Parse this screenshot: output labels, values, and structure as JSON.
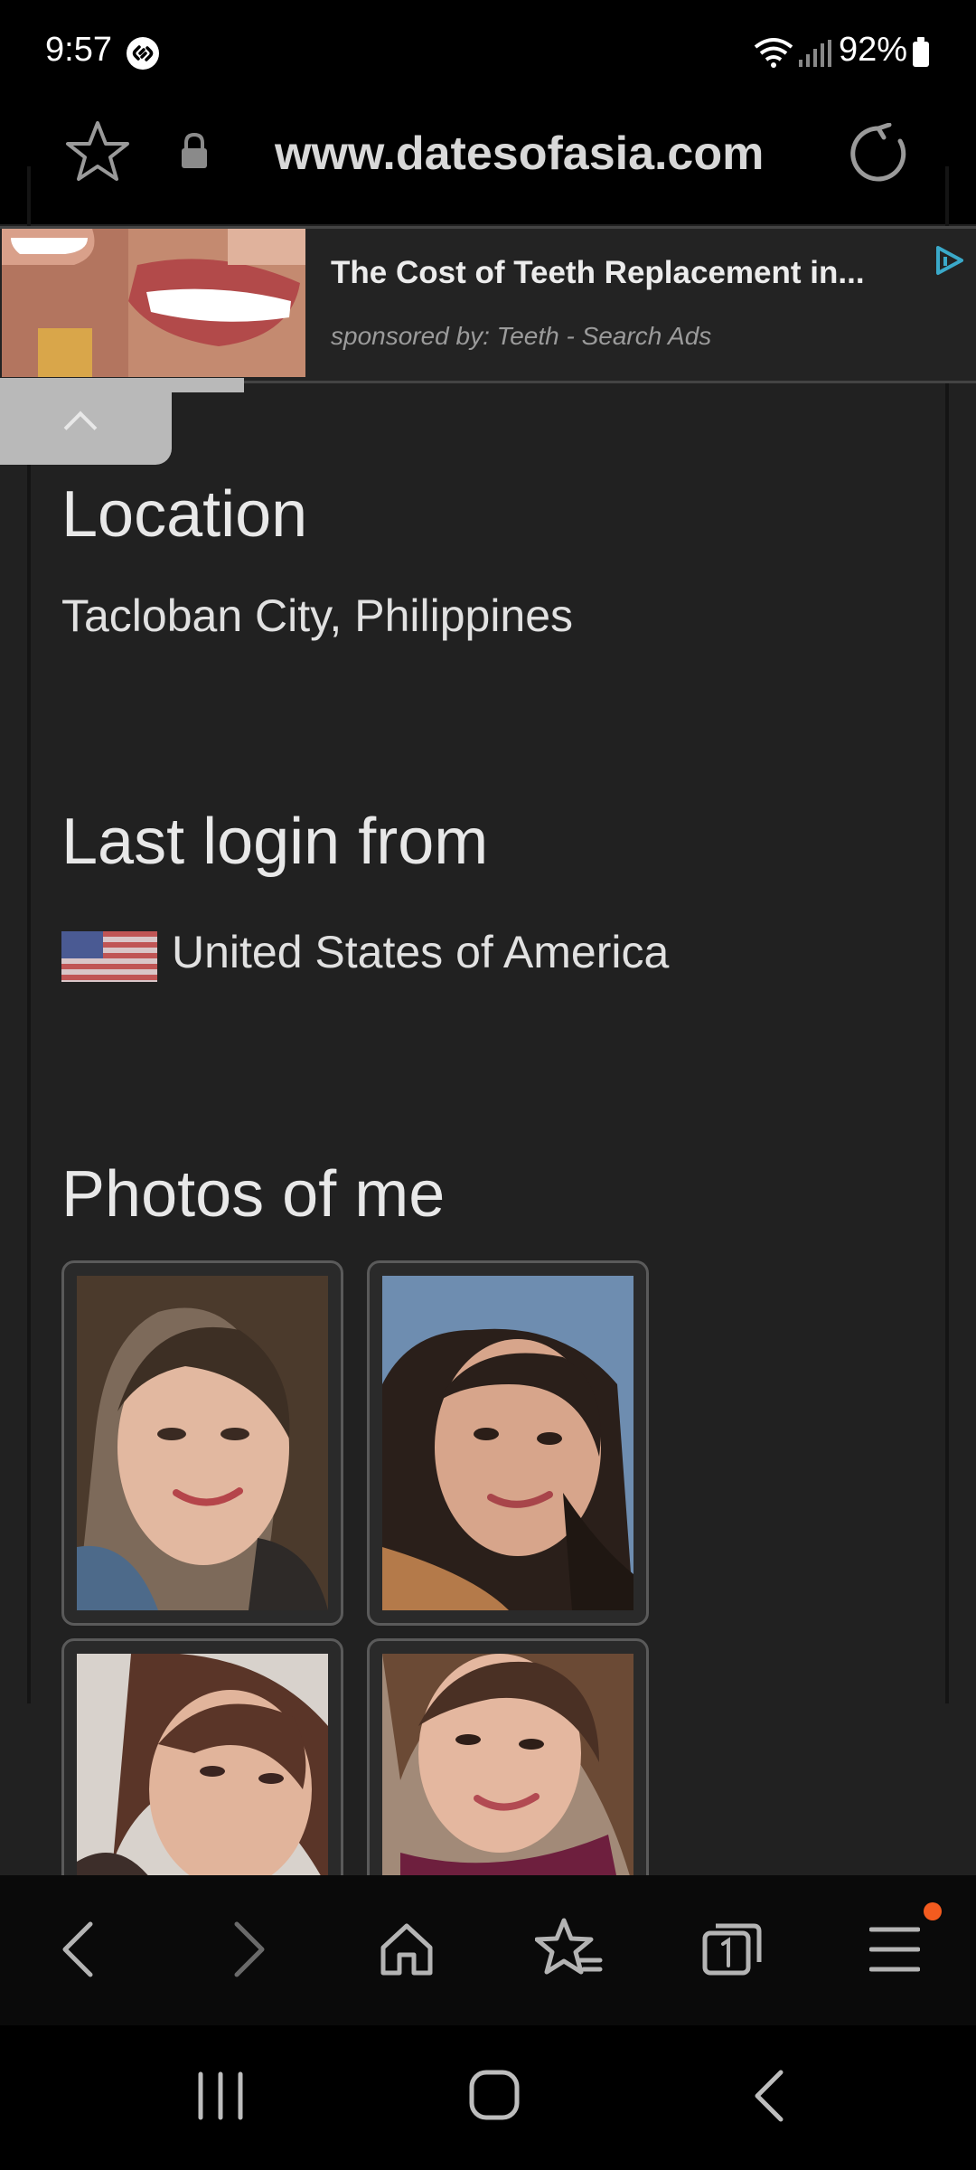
{
  "status_bar": {
    "time": "9:57",
    "battery": "92%"
  },
  "url_bar": {
    "url": "www.datesofasia.com"
  },
  "ad": {
    "title": "The Cost of Teeth Replacement in...",
    "sponsor": "sponsored by: Teeth - Search Ads"
  },
  "profile": {
    "location_heading": "Location",
    "location_value": "Tacloban City, Philippines",
    "last_login_heading": "Last login from",
    "last_login_value": "United States of America",
    "photos_heading": "Photos of me"
  },
  "colors": {
    "accent_dot": "#f35b1f",
    "page_bg": "#212121"
  }
}
